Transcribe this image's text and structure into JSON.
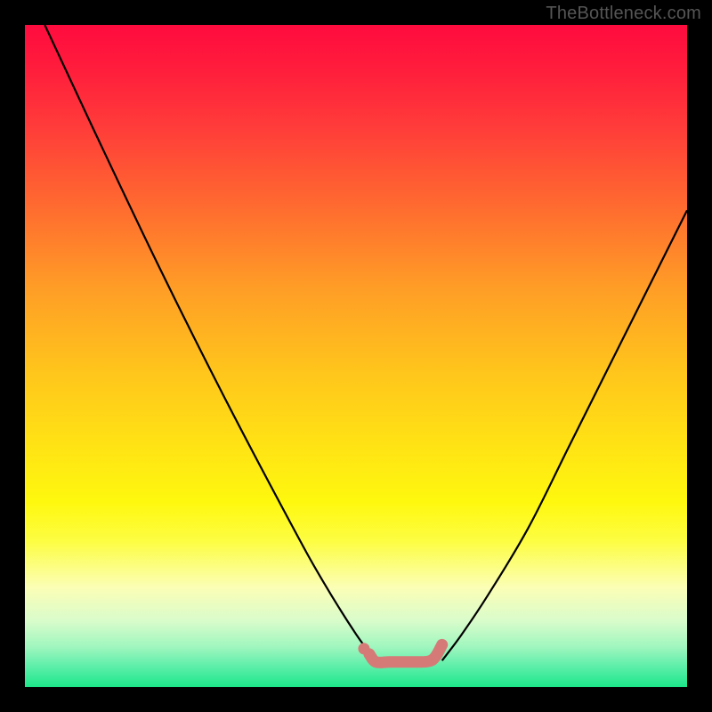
{
  "watermark": "TheBottleneck.com",
  "chart_data": {
    "type": "line",
    "title": "",
    "xlabel": "",
    "ylabel": "",
    "xlim": [
      0,
      100
    ],
    "ylim": [
      0,
      100
    ],
    "series": [
      {
        "name": "left-curve",
        "x": [
          3,
          10,
          20,
          30,
          40,
          45,
          50,
          53
        ],
        "values": [
          100,
          85,
          64,
          44,
          25,
          16,
          8,
          4
        ]
      },
      {
        "name": "right-curve",
        "x": [
          63,
          66,
          70,
          76,
          82,
          88,
          94,
          100
        ],
        "values": [
          4,
          8,
          14,
          24,
          36,
          48,
          60,
          72
        ]
      },
      {
        "name": "bottom-squiggle",
        "x": [
          52,
          53,
          55,
          57,
          59,
          61,
          62,
          63
        ],
        "values": [
          5.0,
          3.8,
          3.8,
          3.8,
          3.8,
          3.9,
          4.6,
          6.4
        ]
      },
      {
        "name": "bottom-dot",
        "x": [
          51.2
        ],
        "values": [
          5.8
        ]
      }
    ],
    "highlight_color": "#d67a77",
    "curve_color": "#000000"
  }
}
